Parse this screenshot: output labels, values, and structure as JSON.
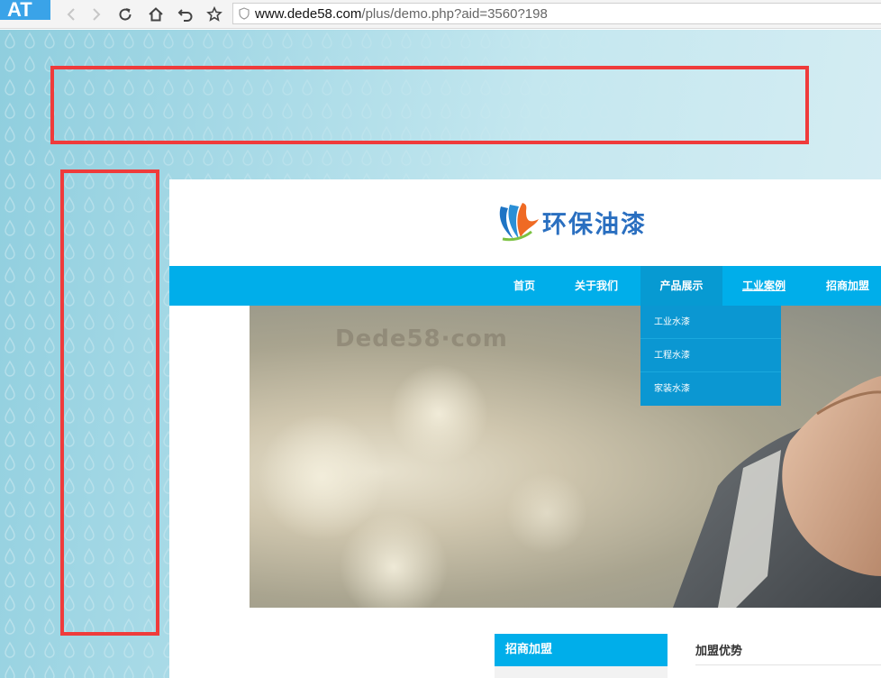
{
  "browser": {
    "app_badge": "AT",
    "url_domain": "www.dede58.com",
    "url_path": "/plus/demo.php?aid=3560?198"
  },
  "site": {
    "logo_text": "环保油漆",
    "nav": [
      {
        "label": "首页"
      },
      {
        "label": "关于我们"
      },
      {
        "label": "产品展示"
      },
      {
        "label": "工业案例"
      },
      {
        "label": "招商加盟"
      }
    ],
    "dropdown": [
      {
        "label": "工业水漆"
      },
      {
        "label": "工程水漆"
      },
      {
        "label": "家装水漆"
      }
    ],
    "banner_watermark": "Dede58·com",
    "sidebar_title": "招商加盟",
    "content_title": "加盟优势"
  },
  "colors": {
    "nav_blue": "#00aeea",
    "dropdown_blue": "#0b97d2",
    "annotation_red": "#ef3b3b",
    "logo_blue": "#2a6fc0"
  }
}
